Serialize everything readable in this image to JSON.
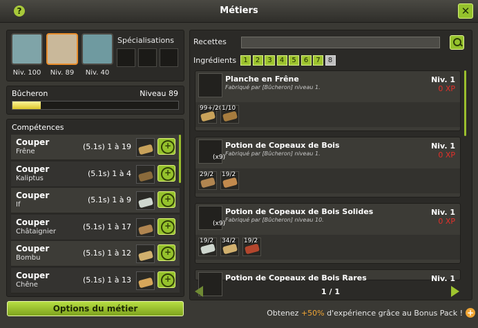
{
  "window": {
    "title": "Métiers",
    "help_label": "?",
    "close_label": "✕"
  },
  "jobs": [
    {
      "level": "Niv. 100",
      "icon": "sheep-icon"
    },
    {
      "level": "Niv. 89",
      "icon": "axe-icon"
    },
    {
      "level": "Niv. 40",
      "icon": "fishing-icon"
    }
  ],
  "specializations_label": "Spécialisations",
  "current_job": {
    "name": "Bûcheron",
    "level": "Niveau 89",
    "progress": 0.17
  },
  "skills_title": "Compétences",
  "skills": [
    {
      "action": "Couper",
      "resource": "Frêne",
      "value": "(5.1s) 1 à 19",
      "color": "#c8a25a"
    },
    {
      "action": "Couper",
      "resource": "Kaliptus",
      "value": "(5.1s) 1 à 4",
      "color": "#8a6a3b"
    },
    {
      "action": "Couper",
      "resource": "If",
      "value": "(5.1s) 1 à 9",
      "color": "#cfd7cf"
    },
    {
      "action": "Couper",
      "resource": "Châtaignier",
      "value": "(5.1s) 1 à 17",
      "color": "#b08550"
    },
    {
      "action": "Couper",
      "resource": "Bombu",
      "value": "(5.1s) 1 à 12",
      "color": "#d1b06e"
    },
    {
      "action": "Couper",
      "resource": "Chêne",
      "value": "(5.1s) 1 à 13",
      "color": "#d6a65a"
    }
  ],
  "options_button": "Options du métier",
  "recipes_panel": {
    "search_label": "Recettes",
    "search_value": "",
    "ingredients_label": "Ingrédients",
    "ingredient_counts": [
      "1",
      "2",
      "3",
      "4",
      "5",
      "6",
      "7",
      "8"
    ],
    "selected_count": "8",
    "pagination": "1 / 1"
  },
  "recipes": [
    {
      "title": "Planche en Frêne",
      "subtitle": "Fabriqué par [Bûcheron] niveau 1.",
      "level": "Niv. 1",
      "xp": "0 XP",
      "count": "",
      "ingredients": [
        {
          "qty": "99+/20",
          "color": "#c8a25a"
        },
        {
          "qty": "1/10",
          "color": "#a67c3e"
        }
      ]
    },
    {
      "title": "Potion de Copeaux de Bois",
      "subtitle": "Fabriqué par [Bûcheron] niveau 1.",
      "level": "Niv. 1",
      "xp": "0 XP",
      "count": "(x9)",
      "ingredients": [
        {
          "qty": "29/2",
          "color": "#b08550"
        },
        {
          "qty": "19/2",
          "color": "#c28a4d"
        }
      ]
    },
    {
      "title": "Potion de Copeaux de Bois Solides",
      "subtitle": "Fabriqué par [Bûcheron] niveau 10.",
      "level": "Niv. 1",
      "xp": "0 XP",
      "count": "(x9)",
      "ingredients": [
        {
          "qty": "19/2",
          "color": "#cfd7cf"
        },
        {
          "qty": "34/2",
          "color": "#d1b06e"
        },
        {
          "qty": "19/2",
          "color": "#b3462d"
        }
      ]
    },
    {
      "title": "Potion de Copeaux de Bois Rares",
      "subtitle": "",
      "level": "Niv. 1",
      "xp": "",
      "count": "",
      "ingredients": []
    }
  ],
  "bonus": {
    "prefix": "Obtenez",
    "highlight": "+50%",
    "suffix": "d'expérience grâce au Bonus Pack !",
    "icon_label": "+"
  }
}
